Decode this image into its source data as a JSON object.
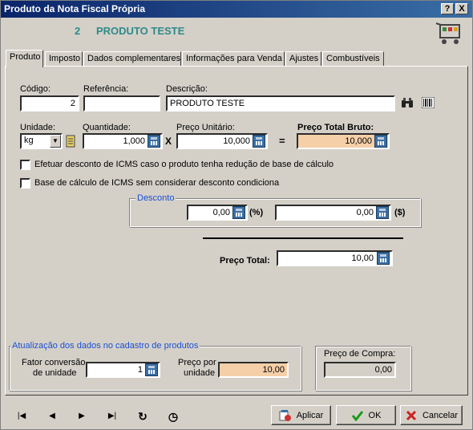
{
  "window": {
    "title": "Produto da Nota Fiscal Própria",
    "help_btn": "?",
    "close_btn": "X"
  },
  "header": {
    "number": "2",
    "name": "PRODUTO TESTE"
  },
  "tabs": [
    {
      "label": "Produto"
    },
    {
      "label": "Imposto"
    },
    {
      "label": "Dados complementares"
    },
    {
      "label": "Informações para Venda"
    },
    {
      "label": "Ajustes"
    },
    {
      "label": "Combustíveis"
    }
  ],
  "fields": {
    "codigo_label": "Código:",
    "codigo_value": "2",
    "referencia_label": "Referência:",
    "referencia_value": "",
    "descricao_label": "Descrição:",
    "descricao_value": "PRODUTO TESTE",
    "unidade_label": "Unidade:",
    "unidade_value": "kg",
    "quantidade_label": "Quantidade:",
    "quantidade_value": "1,000",
    "preco_unit_label": "Preço Unitário:",
    "preco_unit_value": "10,000",
    "preco_bruto_label": "Preço Total Bruto:",
    "preco_bruto_value": "10,000",
    "times": "X",
    "equals": "="
  },
  "checkboxes": [
    {
      "label": "Efetuar desconto de ICMS caso o produto tenha redução de base de cálculo"
    },
    {
      "label": "Base de cálculo de ICMS sem considerar desconto condiciona"
    }
  ],
  "desconto": {
    "legend": "Desconto",
    "pct_value": "0,00",
    "pct_unit": "(%)",
    "val_value": "0,00",
    "val_unit": "($)"
  },
  "total": {
    "label": "Preço Total:",
    "value": "10,00"
  },
  "atualizacao": {
    "legend": "Atualização dos dados no cadastro de produtos",
    "fator_label_1": "Fator conversão",
    "fator_label_2": "de unidade",
    "fator_value": "1",
    "preco_label_1": "Preço por",
    "preco_label_2": "unidade",
    "preco_value": "10,00"
  },
  "compra": {
    "label": "Preço de Compra:",
    "value": "0,00"
  },
  "buttons": {
    "aplicar": "Aplicar",
    "ok": "OK",
    "cancelar": "Cancelar"
  },
  "nav": {
    "first": "|◀",
    "prev": "◀",
    "next": "▶",
    "last": "▶|",
    "refresh": "↻",
    "clock": "◷"
  }
}
